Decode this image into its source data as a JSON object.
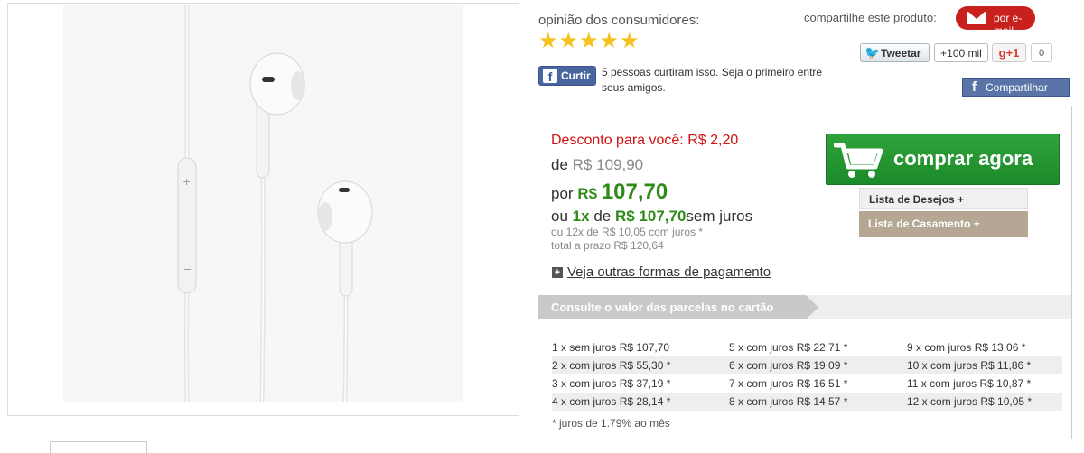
{
  "product": {
    "image_alt": "Fones de ouvido brancos com controle"
  },
  "reviews": {
    "label": "opinião dos consumidores:",
    "stars": "★★★★★",
    "rating": 5
  },
  "social": {
    "share_label": "compartilhe este produto:",
    "email_label": "por e-mail",
    "tweet_label": "Tweetar",
    "tweet_count": "+100 mil",
    "gplus_label": "+1",
    "gplus_count": "0",
    "fb_like_label": "Curtir",
    "fb_like_text": "5 pessoas curtiram isso. Seja o primeiro entre seus amigos.",
    "fb_share_label": "Compartilhar"
  },
  "price": {
    "discount": "Desconto para você: R$ 2,20",
    "from_prefix": "de",
    "from_value": "R$ 109,90",
    "por_prefix": "por",
    "currency": "R$",
    "value": "107,70",
    "ou_prefix": "ou",
    "times": "1x",
    "de": "de",
    "installment_value": "R$ 107,70",
    "sem_juros": "sem juros",
    "installments_line": "ou 12x de R$ 10,05 com juros *",
    "total_line": "total a prazo R$ 120,64",
    "plus_icon": "+",
    "more_payment": "Veja outras formas de pagamento"
  },
  "actions": {
    "buy_label": "comprar agora",
    "wishlist_label": "Lista de Desejos +",
    "wedding_label": "Lista de Casamento +"
  },
  "installments": {
    "header": "Consulte o valor das parcelas no cartão",
    "rows": [
      [
        "1 x sem juros R$ 107,70",
        "5 x com juros R$ 22,71 *",
        "9 x com juros R$ 13,06 *"
      ],
      [
        "2 x com juros R$ 55,30 *",
        "6 x com juros R$ 19,09 *",
        "10 x com juros R$ 11,86 *"
      ],
      [
        "3 x com juros R$ 37,19 *",
        "7 x com juros R$ 16,51 *",
        "11 x com juros R$ 10,87 *"
      ],
      [
        "4 x com juros R$ 28,14 *",
        "8 x com juros R$ 14,57 *",
        "12 x com juros R$ 10,05 *"
      ]
    ],
    "note": "* juros de 1.79% ao mês"
  },
  "colors": {
    "buy": "#2fa33b",
    "discount": "#d0120e",
    "price": "#2e8b1a",
    "email": "#c8201c",
    "facebook": "#4a66a0"
  }
}
